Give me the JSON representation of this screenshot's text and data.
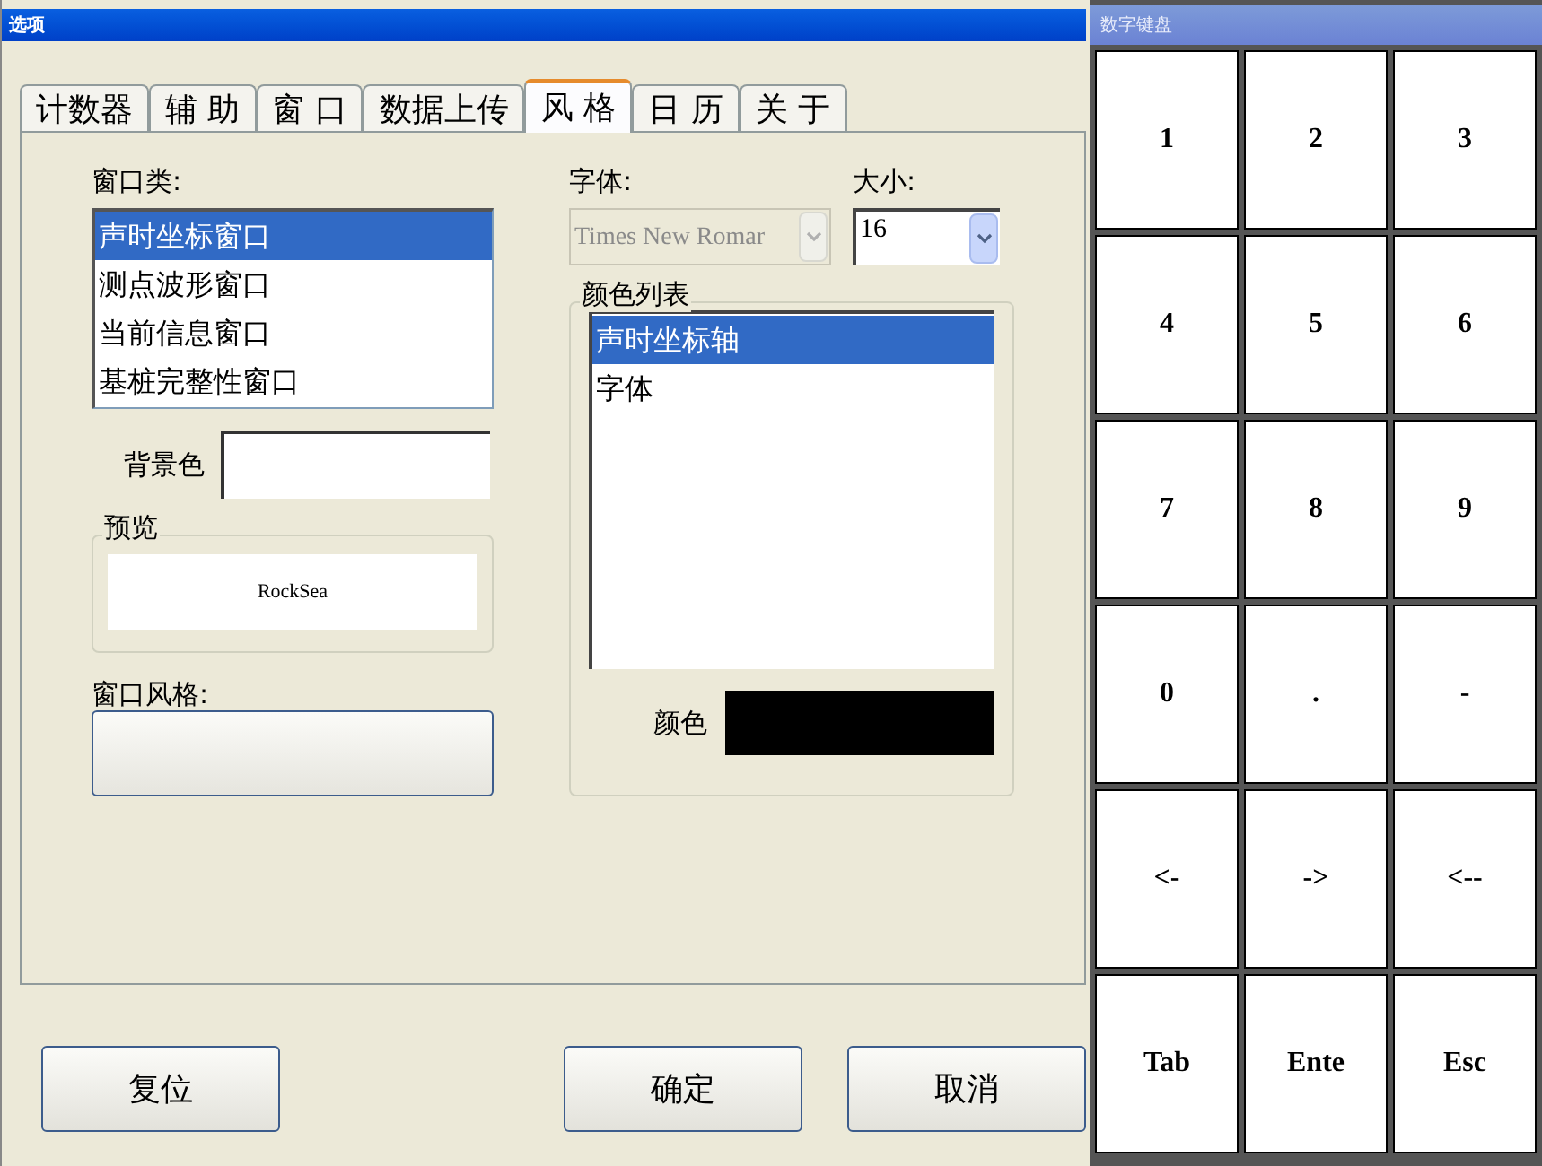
{
  "window": {
    "title": "选项"
  },
  "tabs": [
    {
      "label": "计数器",
      "selected": false
    },
    {
      "label": "辅 助",
      "selected": false
    },
    {
      "label": "窗 口",
      "selected": false
    },
    {
      "label": "数据上传",
      "selected": false
    },
    {
      "label": "风 格",
      "selected": true
    },
    {
      "label": "日 历",
      "selected": false
    },
    {
      "label": "关 于",
      "selected": false
    }
  ],
  "window_class": {
    "label": "窗口类:",
    "items": [
      {
        "label": "声时坐标窗口",
        "selected": true
      },
      {
        "label": "测点波形窗口",
        "selected": false
      },
      {
        "label": "当前信息窗口",
        "selected": false
      },
      {
        "label": "基桩完整性窗口",
        "selected": false
      }
    ]
  },
  "background_color": {
    "label": "背景色"
  },
  "preview": {
    "label": "预览",
    "text": "RockSea"
  },
  "window_style": {
    "label": "窗口风格:"
  },
  "font": {
    "label": "字体:",
    "value": "Times New Romar",
    "disabled": true
  },
  "size": {
    "label": "大小:",
    "value": "16"
  },
  "color_list": {
    "label": "颜色列表",
    "items": [
      {
        "label": "声时坐标轴",
        "selected": true
      },
      {
        "label": "字体",
        "selected": false
      }
    ],
    "color_label": "颜色",
    "color": "#000000"
  },
  "buttons": [
    {
      "label": "复位"
    },
    {
      "label": "确定"
    },
    {
      "label": "取消"
    }
  ],
  "keypad": {
    "title": "数字键盘",
    "keys": [
      "1",
      "2",
      "3",
      "4",
      "5",
      "6",
      "7",
      "8",
      "9",
      "0",
      ".",
      "-",
      "<-",
      "->",
      "<--",
      "Tab",
      "Ente",
      "Esc"
    ]
  }
}
